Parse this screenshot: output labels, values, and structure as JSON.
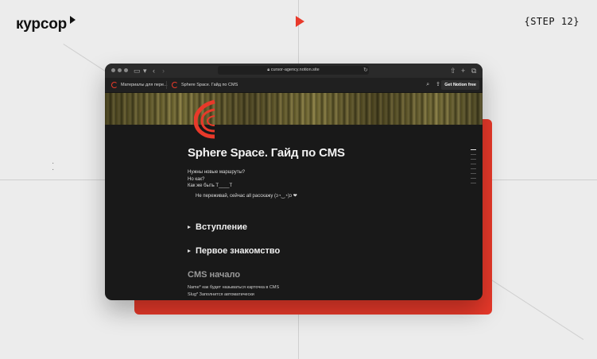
{
  "brand": {
    "name": "курсор"
  },
  "step": {
    "label": "{STEP 12}"
  },
  "browser": {
    "url": "cursor-agency.notion.site",
    "tabs": [
      {
        "label": "Материалы для пере..."
      },
      {
        "label": "Sphere Space. Гайд по CMS"
      }
    ],
    "cta_label": "Get Notion free"
  },
  "page": {
    "title": "Sphere Space. Гайд по CMS",
    "lines": [
      "Нужны новые маршруты?",
      "Но как?",
      "Как же быть Т____Т"
    ],
    "callout": "Не переживай, сейчас all расскажу (ɔ◔‿◔)ɔ ❤",
    "toggles": [
      {
        "label": "Вступление"
      },
      {
        "label": "Первое знакомство"
      }
    ],
    "cms_heading": "CMS начало",
    "cms_lines": [
      "Name* как будет называться карточка в CMS",
      "Slug* Заполнится автоматически"
    ]
  },
  "colors": {
    "accent": "#e8392a",
    "window_bg": "#191919",
    "page_bg": "#ececec"
  }
}
